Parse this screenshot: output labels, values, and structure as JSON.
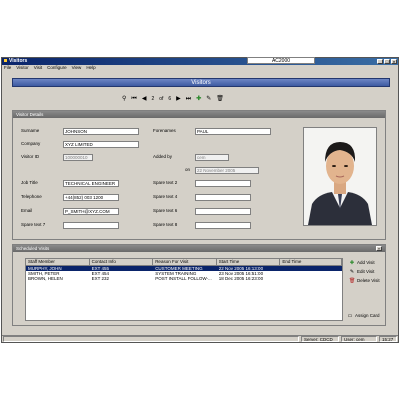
{
  "window": {
    "title": "Visitors",
    "app_name": "AC2000",
    "min": "_",
    "max": "□",
    "close": "×"
  },
  "menu": [
    "File",
    "Visitor",
    "Visit",
    "Configure",
    "View",
    "Help"
  ],
  "banner": {
    "title": "Visitors"
  },
  "nav": {
    "current": "2",
    "of_label": "of",
    "total": "6"
  },
  "details": {
    "heading": "Visitor Details",
    "surname": {
      "label": "Surname",
      "value": "JOHNSON"
    },
    "forenames": {
      "label": "Forenames",
      "value": "PAUL"
    },
    "company": {
      "label": "Company",
      "value": "XYZ LIMITED"
    },
    "visitor_id": {
      "label": "Visitor ID",
      "value": "100000010"
    },
    "added_by": {
      "label": "Added by",
      "value": "cem"
    },
    "on": {
      "label": "on",
      "value": "22 November 2005"
    },
    "job_title": {
      "label": "Job Title",
      "value": "TECHNICAL ENGINEER"
    },
    "telephone": {
      "label": "Telephone",
      "value": "+44(852) 003 1200"
    },
    "email": {
      "label": "Email",
      "value": "P_SMITH@XYZ.COM"
    },
    "spare7": {
      "label": "Spare text 7",
      "value": ""
    },
    "spare2": {
      "label": "Spare text 2",
      "value": ""
    },
    "spare4": {
      "label": "Spare text 4",
      "value": ""
    },
    "spare6": {
      "label": "Spare text 6",
      "value": ""
    },
    "spare8": {
      "label": "Spare text 8",
      "value": ""
    }
  },
  "visits": {
    "heading": "Scheduled Visits",
    "columns": [
      "Staff Member",
      "Contact Info",
      "Reason For Visit",
      "Start Time",
      "End Time"
    ],
    "rows": [
      {
        "staff": "MURPHY, JOHN",
        "contact": "EXT 455",
        "reason": "CUSTOMER MEETING",
        "start": "22 Nov 2005 16:13:00",
        "end": "",
        "selected": true
      },
      {
        "staff": "SMITH, PETER",
        "contact": "EXT 454",
        "reason": "SYSTEM TRAINING",
        "start": "23 Nov 2005 16:51:00",
        "end": "",
        "selected": false
      },
      {
        "staff": "BROWN, HELEN",
        "contact": "EXT 232",
        "reason": "POST INSTALL FOLLOW-...",
        "start": "18 Dec 2005 16:23:00",
        "end": "",
        "selected": false
      }
    ],
    "actions": {
      "add": "Add Visit",
      "edit": "Edit Visit",
      "delete": "Delete Visit",
      "assign": "Assign Card"
    }
  },
  "status": {
    "server": "Server: CDCD",
    "user": "User: cem",
    "time": "15:27"
  },
  "colors": {
    "titlebar": "#0a246a",
    "banner": "#3d5aa2",
    "selected_row": "#0a246a",
    "add_icon": "#2e8b2e",
    "delete_icon": "#b22222"
  }
}
